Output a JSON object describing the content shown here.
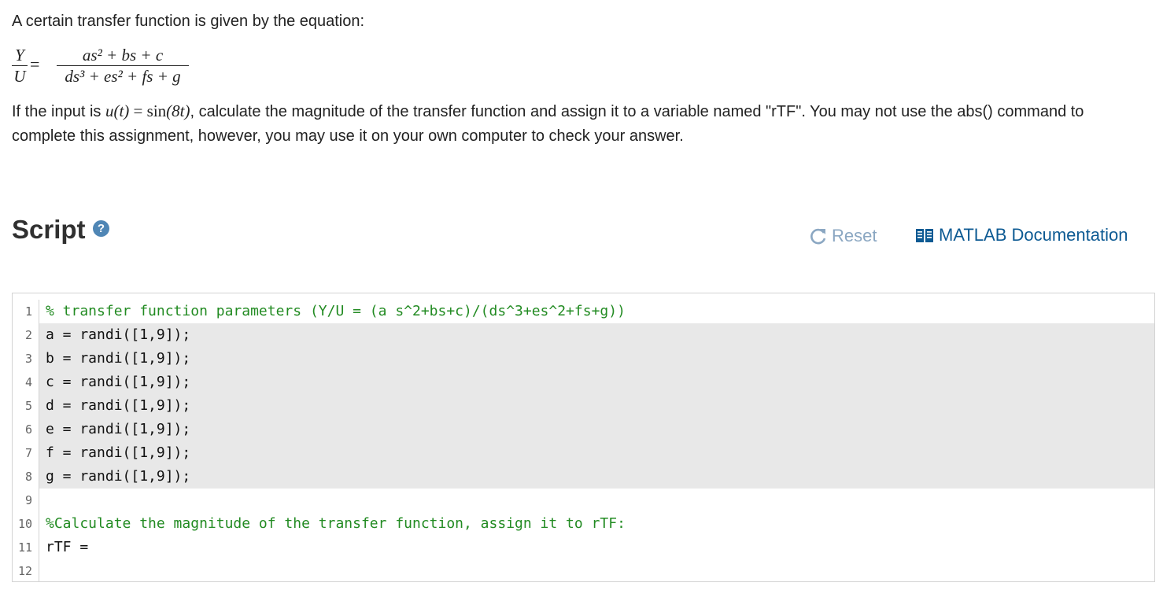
{
  "problem": {
    "intro": "A certain transfer function is given by the equation:",
    "equation": {
      "lhs_numerator": "Y",
      "lhs_denominator": "U",
      "equals": "=",
      "rhs_numerator": "as² + bs + c",
      "rhs_denominator": "ds³ + es² + fs + g"
    },
    "paragraph": {
      "before_math": "If the input is ",
      "input_lhs": "u(t)",
      "input_equals": " = ",
      "input_rhs_func": "sin",
      "input_rhs_arg": "(8t)",
      "after_math": ", calculate the magnitude of the transfer function and assign it to a variable named \"rTF\".  You may not use the abs() command to complete this assignment, however, you may use it on your own computer to check your answer."
    }
  },
  "script_section": {
    "title": "Script",
    "help_icon": "question-circle-icon",
    "help_glyph": "?",
    "reset_label": "Reset",
    "reset_icon": "refresh-icon",
    "doc_label": "MATLAB Documentation",
    "doc_icon": "book-icon",
    "colors": {
      "link": "#0d5a93",
      "reset": "#8ba7c2",
      "comment": "#228b22",
      "locked_bg": "#e8e8e8"
    }
  },
  "editor": {
    "lines": [
      {
        "num": "1",
        "text": "% transfer function parameters (Y/U = (a s^2+bs+c)/(ds^3+es^2+fs+g))"
      },
      {
        "num": "2",
        "text": "a = randi([1,9]);"
      },
      {
        "num": "3",
        "text": "b = randi([1,9]);"
      },
      {
        "num": "4",
        "text": "c = randi([1,9]);"
      },
      {
        "num": "5",
        "text": "d = randi([1,9]);"
      },
      {
        "num": "6",
        "text": "e = randi([1,9]);"
      },
      {
        "num": "7",
        "text": "f = randi([1,9]);"
      },
      {
        "num": "8",
        "text": "g = randi([1,9]);"
      },
      {
        "num": "9",
        "text": ""
      },
      {
        "num": "10",
        "text": "%Calculate the magnitude of the transfer function, assign it to rTF:"
      },
      {
        "num": "11",
        "text": "rTF = "
      },
      {
        "num": "12",
        "text": ""
      }
    ]
  }
}
